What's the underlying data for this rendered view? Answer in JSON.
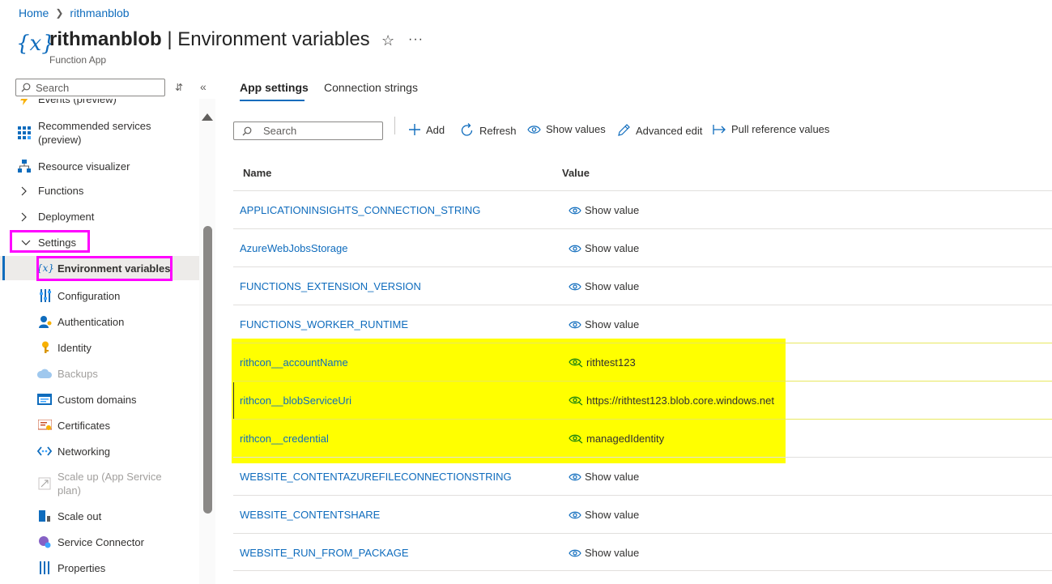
{
  "breadcrumb": {
    "home": "Home",
    "resource": "rithmanblob"
  },
  "header": {
    "resource_name": "rithmanblob",
    "separator": " | ",
    "page": "Environment variables",
    "subtitle": "Function App",
    "icon": "function-variable-icon"
  },
  "left": {
    "search_placeholder": "Search"
  },
  "sidebar": {
    "items": [
      {
        "label": "Events (preview)",
        "icon": "bolt-icon"
      },
      {
        "label": "Recommended services (preview)",
        "icon": "grid-icon"
      },
      {
        "label": "Resource visualizer",
        "icon": "hierarchy-icon"
      },
      {
        "label": "Functions",
        "icon": "chevron-right-icon"
      },
      {
        "label": "Deployment",
        "icon": "chevron-right-icon"
      },
      {
        "label": "Settings",
        "icon": "chevron-down-icon"
      },
      {
        "label": "Environment variables",
        "icon": "function-variable-icon"
      },
      {
        "label": "Configuration",
        "icon": "sliders-icon"
      },
      {
        "label": "Authentication",
        "icon": "user-key-icon"
      },
      {
        "label": "Identity",
        "icon": "key-icon"
      },
      {
        "label": "Backups",
        "icon": "cloud-icon"
      },
      {
        "label": "Custom domains",
        "icon": "domain-icon"
      },
      {
        "label": "Certificates",
        "icon": "certificate-icon"
      },
      {
        "label": "Networking",
        "icon": "network-icon"
      },
      {
        "label": "Scale up (App Service plan)",
        "icon": "scale-up-icon"
      },
      {
        "label": "Scale out",
        "icon": "scale-out-icon"
      },
      {
        "label": "Service Connector",
        "icon": "connector-icon"
      },
      {
        "label": "Properties",
        "icon": "properties-icon"
      }
    ]
  },
  "tabs": [
    {
      "label": "App settings"
    },
    {
      "label": "Connection strings"
    }
  ],
  "toolbar": {
    "search_placeholder": "Search",
    "add": "Add",
    "refresh": "Refresh",
    "show_values": "Show values",
    "advanced_edit": "Advanced edit",
    "pull_reference": "Pull reference values"
  },
  "table": {
    "headers": {
      "name": "Name",
      "value": "Value"
    },
    "rows": [
      {
        "name": "APPLICATIONINSIGHTS_CONNECTION_STRING",
        "value": "Show value"
      },
      {
        "name": "AzureWebJobsStorage",
        "value": "Show value"
      },
      {
        "name": "FUNCTIONS_EXTENSION_VERSION",
        "value": "Show value"
      },
      {
        "name": "FUNCTIONS_WORKER_RUNTIME",
        "value": "Show value"
      },
      {
        "name": "rithcon__accountName",
        "value": "rithtest123"
      },
      {
        "name": "rithcon__blobServiceUri",
        "value": "https://rithtest123.blob.core.windows.net"
      },
      {
        "name": "rithcon__credential",
        "value": "managedIdentity"
      },
      {
        "name": "WEBSITE_CONTENTAZUREFILECONNECTIONSTRING",
        "value": "Show value"
      },
      {
        "name": "WEBSITE_CONTENTSHARE",
        "value": "Show value"
      },
      {
        "name": "WEBSITE_RUN_FROM_PACKAGE",
        "value": "Show value"
      }
    ]
  },
  "colors": {
    "accent": "#0f6cbd",
    "highlight_yellow": "#ffff00",
    "highlight_magenta": "#ff00ff",
    "revealed_value_icon": "#107c10"
  }
}
